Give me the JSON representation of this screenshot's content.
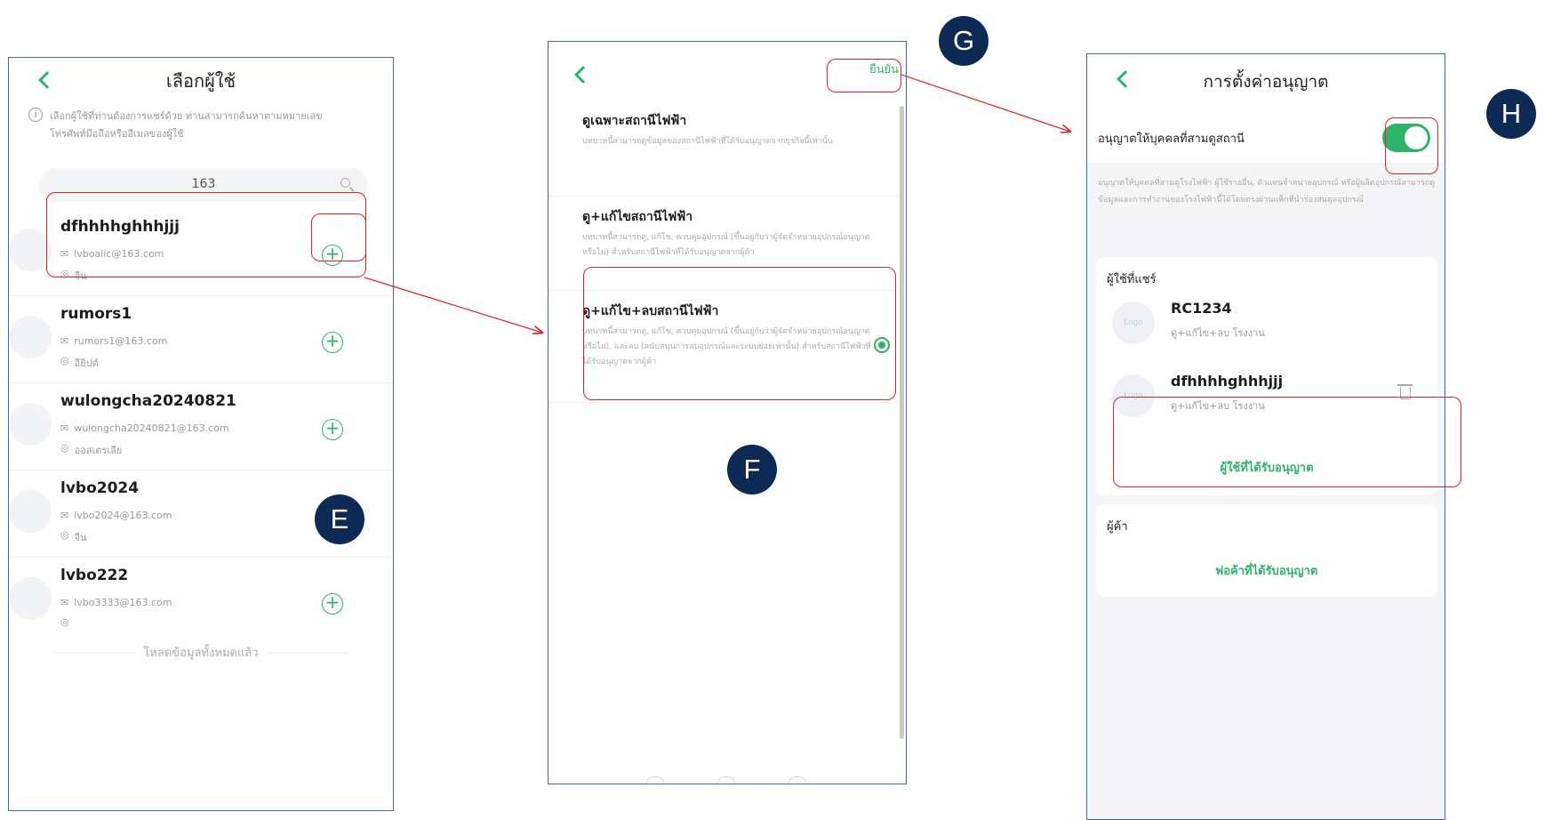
{
  "screen1": {
    "title": "เลือกผู้ใช้",
    "hint": "เลือกผู้ใช้ที่ท่านต้องการแชร์ด้วย ท่านสามารถค้นหาตามหมายเลขโทรศัพท์มือถือหรืออีเมลของผู้ใช้",
    "search_value": "163",
    "users": [
      {
        "name": "dfhhhhghhhjjj",
        "email": "lvboalic@163.com",
        "location": "จีน"
      },
      {
        "name": "rumors1",
        "email": "rumors1@163.com",
        "location": "อียิปต์"
      },
      {
        "name": "wulongcha20240821",
        "email": "wulongcha20240821@163.com",
        "location": "ออสเตรเลีย"
      },
      {
        "name": "lvbo2024",
        "email": "lvbo2024@163.com",
        "location": "จีน"
      },
      {
        "name": "lvbo222",
        "email": "lvbo3333@163.com",
        "location": ""
      }
    ],
    "loaded_all": "โหลดข้อมูลทั้งหมดแล้ว"
  },
  "screen2": {
    "confirm_label": "ยืนยัน",
    "roles": [
      {
        "title": "ดูเฉพาะสถานีไฟฟ้า",
        "desc": "บทบาทนี้สามารถดูข้อมูลของสถานีไฟฟ้าที่ได้รับอนุญาตจากธุรกิจนี้เท่านั้น"
      },
      {
        "title": "ดู+แก้ไขสถานีไฟฟ้า",
        "desc": "บทบาทนี้สามารถดู, แก้ไข, ควบคุมอุปกรณ์ (ขึ้นอยู่กับว่าผู้จัดจำหน่ายอุปกรณ์อนุญาตหรือไม่) สำหรับสถานีไฟฟ้าที่ได้รับอนุญาตจากผู้ค้า"
      },
      {
        "title": "ดู+แก้ไข+ลบสถานีไฟฟ้า",
        "desc": "บทบาทนี้สามารถดู, แก้ไข, ควบคุมอุปกรณ์ (ขึ้นอยู่กับว่าผู้จัดจำหน่ายอุปกรณ์อนุญาตหรือไม่), และลบ (สนับสนุนการลบอุปกรณ์และระบบย่อยเท่านั้น) สำหรับสถานีไฟฟ้าที่ได้รับอนุญาตจากผู้ค้า"
      }
    ],
    "selected_role": 2
  },
  "screen3": {
    "title": "การตั้งค่าอนุญาต",
    "allow_label": "อนุญาตให้บุคคลที่สามดูสถานี",
    "allow_enabled": true,
    "allow_desc": "อนุญาตให้บุคคลที่สามดูโรงไฟฟ้า ผู้ใช้รายอื่น, ตัวแทนจำหน่ายอุปกรณ์ หรือผู้ผลิตอุปกรณ์สามารถดูข้อมูลและการทำงานของโรงไฟฟ้านี้ได้โดยตรงผ่านแพ็กที่นำร่องสมดุลอุปกรณ์",
    "shared_users_header": "ผู้ใช้ที่แชร์",
    "shared_users": [
      {
        "name": "RC1234",
        "role": "ดู+แก้ไข+ลบ โรงงาน",
        "logo": "Logo"
      },
      {
        "name": "dfhhhhghhhjjj",
        "role": "ดู+แก้ไข+ลบ โรงงาน",
        "logo": "Logo"
      }
    ],
    "authorized_users_link": "ผู้ใช้ที่ได้รับอนุญาต",
    "dealer_header": "ผู้ค้า",
    "authorized_dealer_link": "พ่อค้าที่ได้รับอนุญาต"
  },
  "annotations": {
    "E": "E",
    "F": "F",
    "G": "G",
    "H": "H"
  },
  "colors": {
    "accent": "#2fb36a",
    "highlight": "#e02424",
    "badge": "#0d2a55"
  }
}
